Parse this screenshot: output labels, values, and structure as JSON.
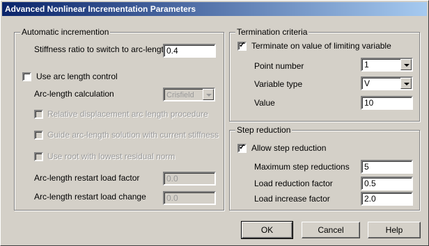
{
  "window": {
    "title": "Advanced Nonlinear Incrementation Parameters"
  },
  "auto": {
    "legend": "Automatic incremention",
    "stiffness_label": "Stiffness ratio to switch to arc-length",
    "stiffness_value": "0.4",
    "use_arc_label": "Use arc length control",
    "use_arc_checked": false,
    "arc_calc_label": "Arc-length calculation",
    "arc_calc_value": "Crisfield",
    "rel_disp_label": "Relative displacement arc length procedure",
    "guide_label": "Guide arc-length solution with current stiffness",
    "root_label": "Use root with lowest residual norm",
    "restart_factor_label": "Arc-length restart load factor",
    "restart_factor_value": "0.0",
    "restart_change_label": "Arc-length restart load change",
    "restart_change_value": "0.0"
  },
  "termination": {
    "legend": "Termination criteria",
    "terminate_label": "Terminate on value of limiting variable",
    "terminate_checked": true,
    "check_mark": "✓",
    "point_label": "Point number",
    "point_value": "1",
    "vartype_label": "Variable type",
    "vartype_value": "V",
    "value_label": "Value",
    "value_value": "10"
  },
  "step": {
    "legend": "Step reduction",
    "allow_label": "Allow step reduction",
    "allow_checked": true,
    "check_mark": "✓",
    "max_label": "Maximum step reductions",
    "max_value": "5",
    "load_red_label": "Load reduction factor",
    "load_red_value": "0.5",
    "load_inc_label": "Load increase factor",
    "load_inc_value": "2.0"
  },
  "buttons": {
    "ok": "OK",
    "cancel": "Cancel",
    "help": "Help"
  }
}
